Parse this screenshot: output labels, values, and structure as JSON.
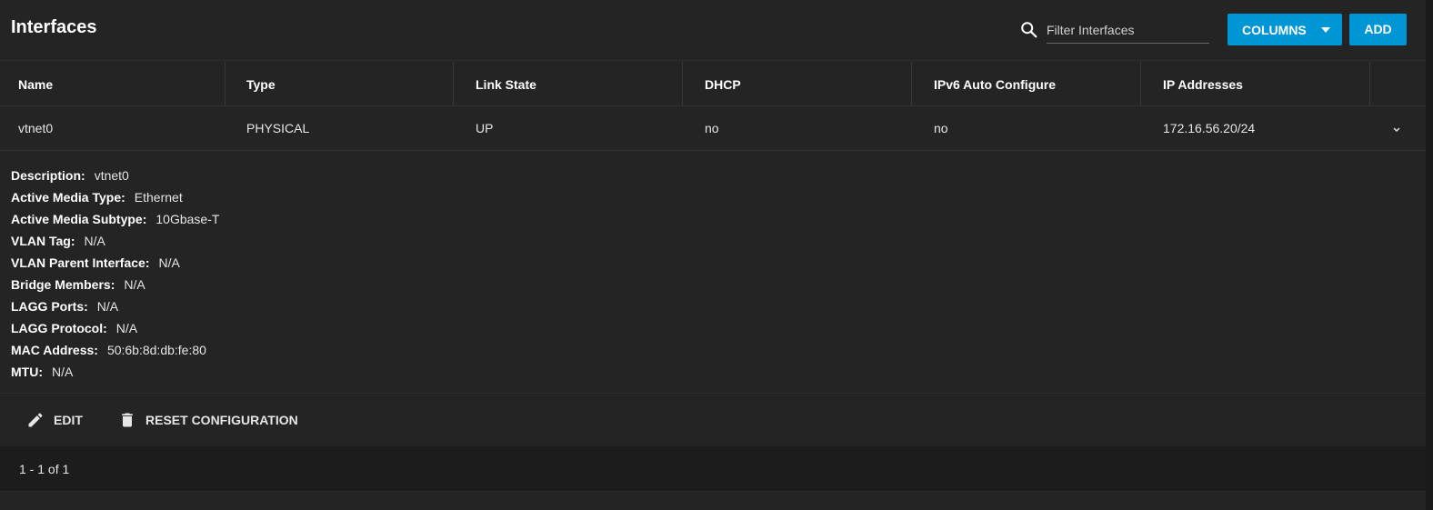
{
  "toolbar": {
    "title": "Interfaces",
    "search_placeholder": "Filter Interfaces",
    "columns_label": "COLUMNS",
    "add_label": "ADD"
  },
  "table": {
    "columns": [
      "Name",
      "Type",
      "Link State",
      "DHCP",
      "IPv6 Auto Configure",
      "IP Addresses"
    ],
    "rows": [
      [
        "vtnet0",
        "PHYSICAL",
        "UP",
        "no",
        "no",
        "172.16.56.20/24"
      ]
    ]
  },
  "details": [
    {
      "label": "Description:",
      "value": "vtnet0"
    },
    {
      "label": "Active Media Type:",
      "value": "Ethernet"
    },
    {
      "label": "Active Media Subtype:",
      "value": "10Gbase-T"
    },
    {
      "label": "VLAN Tag:",
      "value": "N/A"
    },
    {
      "label": "VLAN Parent Interface:",
      "value": "N/A"
    },
    {
      "label": "Bridge Members:",
      "value": "N/A"
    },
    {
      "label": "LAGG Ports:",
      "value": "N/A"
    },
    {
      "label": "LAGG Protocol:",
      "value": "N/A"
    },
    {
      "label": "MAC Address:",
      "value": "50:6b:8d:db:fe:80"
    },
    {
      "label": "MTU:",
      "value": "N/A"
    }
  ],
  "actions": {
    "edit_label": "EDIT",
    "reset_label": "RESET CONFIGURATION"
  },
  "footer": {
    "paginator": "1 - 1 of 1"
  },
  "colors": {
    "accent": "#0095d5",
    "background": "#242424"
  },
  "icons": [
    "search-icon",
    "caret-down-icon",
    "chevron-down-icon",
    "pencil-icon",
    "trash-icon"
  ]
}
